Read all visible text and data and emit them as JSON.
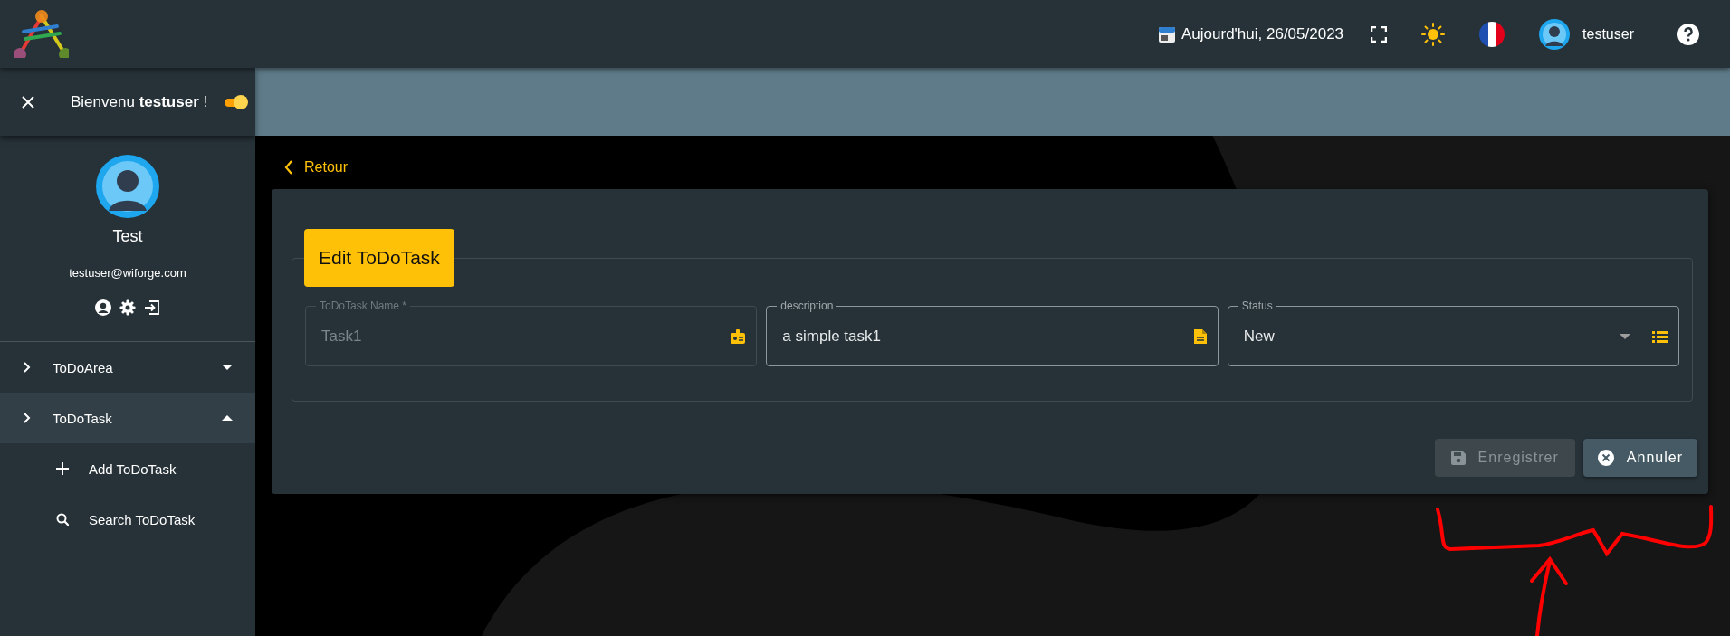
{
  "header": {
    "date": "Aujourd'hui, 26/05/2023",
    "username": "testuser"
  },
  "sidebar": {
    "welcome": "Bienvenu **testuser** !",
    "switch_on": true,
    "profile": {
      "name": "Test",
      "email": "testuser@wiforge.com"
    },
    "menu": [
      {
        "label": "ToDoArea",
        "expanded": false,
        "selected": false
      },
      {
        "label": "ToDoTask",
        "expanded": true,
        "selected": true,
        "children": [
          {
            "label": "Add ToDoTask",
            "kind": "add"
          },
          {
            "label": "Search ToDoTask",
            "kind": "search"
          }
        ]
      }
    ]
  },
  "back_link": "Retour",
  "form": {
    "title": "Edit ToDoTask",
    "fields": [
      {
        "label": "ToDoTask Name *",
        "value": "Task1",
        "kind": "text",
        "disabled": true
      },
      {
        "label": "description",
        "value": "a simple task1",
        "kind": "note",
        "disabled": false
      },
      {
        "label": "Status",
        "value": "New",
        "kind": "select",
        "disabled": false
      }
    ],
    "buttons": [
      {
        "label": "Enregistrer",
        "kind": "save",
        "disabled": true
      },
      {
        "label": "Annuler",
        "kind": "cancel",
        "disabled": false
      }
    ]
  }
}
